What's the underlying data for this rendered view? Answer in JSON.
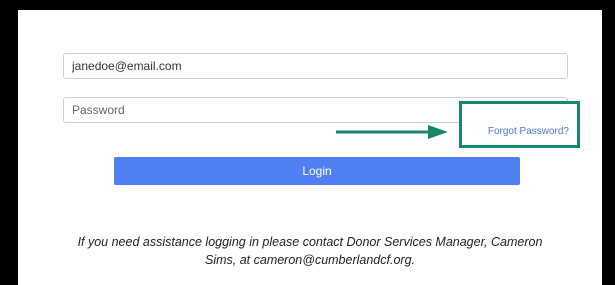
{
  "login_form": {
    "email_value": "janedoe@email.com",
    "password_placeholder": "Password",
    "forgot_password_link": "Forgot Password?",
    "login_button": "Login",
    "help_text_line1": "If you need assistance logging in please contact Donor Services Manager, Cameron",
    "help_text_line2": "Sims, at cameron@cumberlandcf.org."
  },
  "colors": {
    "annotation_green": "#17876a",
    "login_blue": "#4f7ff1",
    "link_blue": "#4a79c8"
  },
  "icons": {
    "annotation_arrow": "right-arrow-icon"
  }
}
